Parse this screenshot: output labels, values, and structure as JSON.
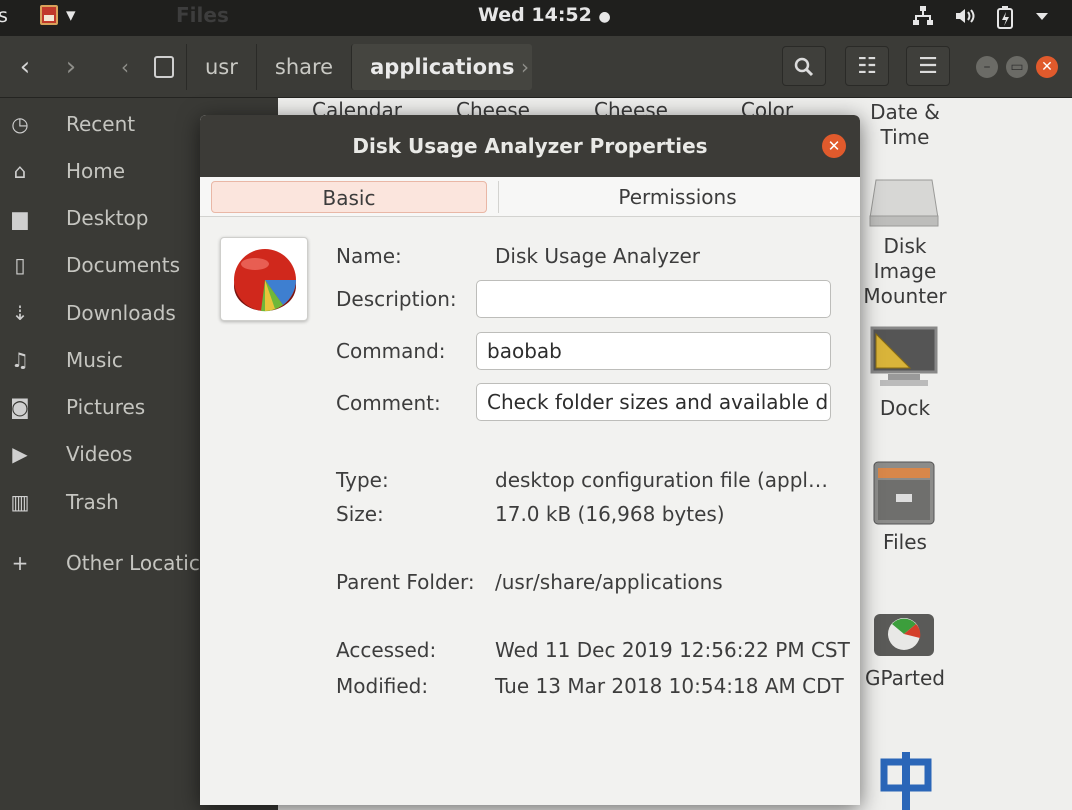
{
  "topbar": {
    "left_fragment": "s",
    "app_name": "Files",
    "app_menu_arrow": "▾",
    "clock": "Wed 14:52",
    "clock_dot": "●",
    "system_icons": [
      "network-icon",
      "volume-icon",
      "battery-icon",
      "system-menu-arrow-icon"
    ]
  },
  "header": {
    "back": "‹",
    "forward": "›",
    "path_prev": "‹",
    "path": [
      "usr",
      "share",
      "applications"
    ],
    "path_next": "›",
    "search_icon": "⚲",
    "view_icon": "☷",
    "menu_icon": "☰"
  },
  "sidebar": {
    "items": [
      {
        "label": "Recent",
        "icon": "clock-icon",
        "glyph": "◷"
      },
      {
        "label": "Home",
        "icon": "home-icon",
        "glyph": "⌂"
      },
      {
        "label": "Desktop",
        "icon": "folder-icon",
        "glyph": "▆"
      },
      {
        "label": "Documents",
        "icon": "document-icon",
        "glyph": "▯"
      },
      {
        "label": "Downloads",
        "icon": "download-icon",
        "glyph": "⇣"
      },
      {
        "label": "Music",
        "icon": "music-icon",
        "glyph": "♫"
      },
      {
        "label": "Pictures",
        "icon": "camera-icon",
        "glyph": "◙"
      },
      {
        "label": "Videos",
        "icon": "video-icon",
        "glyph": "▶"
      },
      {
        "label": "Trash",
        "icon": "trash-icon",
        "glyph": "▥"
      }
    ],
    "other": {
      "label": "Other Locatic",
      "glyph": "+"
    }
  },
  "grid": {
    "top_labels": [
      "Calendar",
      "Cheese",
      "Cheese",
      "Color"
    ],
    "items": [
      "Date &\nTime",
      "Disk Image\nMounter",
      "Dock",
      "Files",
      "GParted"
    ]
  },
  "dialog": {
    "title": "Disk Usage Analyzer Properties",
    "close": "✕",
    "tabs": {
      "basic": "Basic",
      "permissions": "Permissions"
    },
    "name_label": "Name:",
    "name_value": "Disk Usage Analyzer",
    "description_label": "Description:",
    "description_value": "",
    "command_label": "Command:",
    "command_value": "baobab",
    "comment_label": "Comment:",
    "comment_value": "Check folder sizes and available di",
    "type_label": "Type:",
    "type_value": "desktop configuration file (appl…",
    "size_label": "Size:",
    "size_value": "17.0 kB (16,968 bytes)",
    "parent_label": "Parent Folder:",
    "parent_value": "/usr/share/applications",
    "accessed_label": "Accessed:",
    "accessed_value": "Wed 11 Dec 2019 12:56:22 PM CST",
    "modified_label": "Modified:",
    "modified_value": "Tue 13 Mar 2018 10:54:18 AM CDT"
  }
}
